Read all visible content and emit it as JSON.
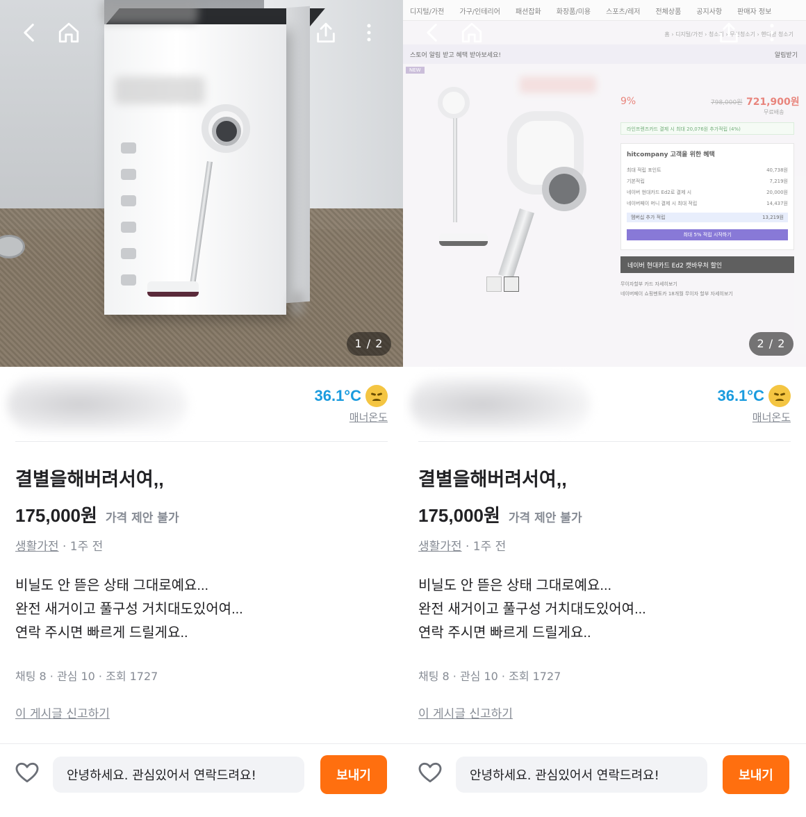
{
  "listing": {
    "title": "결별을해버려서여,,",
    "price": "175,000원",
    "price_note": "가격 제안 불가",
    "category": "생활가전",
    "posted": "1주 전",
    "meta_separator": " · ",
    "description": [
      "비닐도 안 뜯은 상태 그대로예요...",
      "완전 새거이고 풀구성 거치대도있어여...",
      "연락 주시면 빠르게 드릴게요.."
    ],
    "stats": "채팅 8 · 관심 10 · 조회 1727",
    "report_link": "이 게시글 신고하기"
  },
  "seller": {
    "temperature": "36.1°C",
    "manner_label": "매너온도",
    "temperature_color": "#1a9bde"
  },
  "chat": {
    "message": "안녕하세요. 관심있어서 연락드려요!",
    "send_label": "보내기",
    "send_color": "#ff6f0f"
  },
  "screens": [
    {
      "counter": "1 / 2"
    },
    {
      "counter": "2 / 2"
    }
  ],
  "web_capture": {
    "nav": [
      "디지털/가전",
      "가구/인테리어",
      "패션잡화",
      "화장품/미용",
      "스포츠/레저",
      "전체상품",
      "공지사항",
      "판매자 정보"
    ],
    "breadcrumb": "홈 › 디지털/가전 › 청소기 › 무선청소기 › 핸디형 청소기",
    "banner": "스토어 알림 받고 혜택 받아보세요!",
    "banner_action": "알림받기",
    "new_badge": "NEW",
    "discount": "9%",
    "old_price": "798,000원",
    "price": "721,900원",
    "shipping": "무료배송",
    "card_line": "라인프렌즈카드 결제 시 최대 20,076원 추가적립 (4%)",
    "benefit_title": "hitcompany 고객을 위한 혜택",
    "benefit_rows": [
      {
        "label": "최대 적립 포인트",
        "value": "40,738원"
      },
      {
        "label": "기본적립",
        "value": "7,219원"
      },
      {
        "label": "네이버 현대카드 Ed2로 결제 시",
        "value": "20,000원"
      },
      {
        "label": "네이버페이 머니 결제 시 최대 적립",
        "value": "14,437원"
      }
    ],
    "membership_label": "멤버십 추가 적립",
    "membership_value": "13,219원",
    "start_label": "최대 5% 적립 시작하기",
    "ad_banner": "네이버 현대카드 Ed2 캣바우처 할인",
    "info_lines": [
      "무이자할부   카드 자세히보기",
      "네이버페이 쇼핑멘토카 18개월 무이자 할부   자세히보기"
    ]
  },
  "icons": {
    "back": "back-arrow-icon",
    "home": "home-icon",
    "share": "share-icon",
    "more": "more-vertical-icon",
    "heart": "heart-icon",
    "temperature": "sad-face-icon"
  }
}
